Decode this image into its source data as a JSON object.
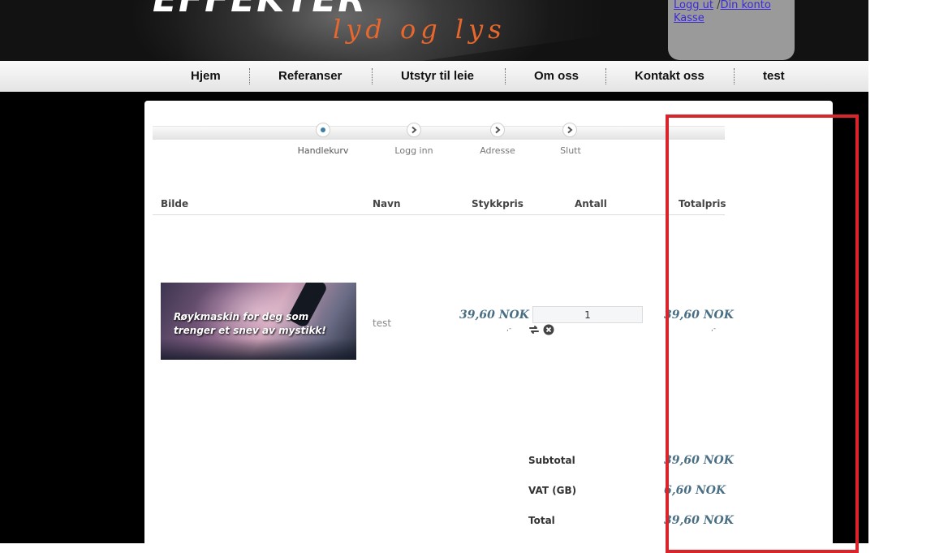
{
  "header": {
    "logo_main": "EFFEKTER",
    "logo_sub": "lyd og lys",
    "logout_link": "Logg ut",
    "separator": " /",
    "account_link": "Din konto",
    "checkout_link": "Kasse"
  },
  "nav": {
    "items": [
      {
        "label": "Hjem"
      },
      {
        "label": "Referanser"
      },
      {
        "label": "Utstyr til leie"
      },
      {
        "label": "Om oss"
      },
      {
        "label": "Kontakt oss"
      },
      {
        "label": "test"
      }
    ]
  },
  "steps": [
    {
      "label": "Handlekurv",
      "active": true
    },
    {
      "label": "Logg inn",
      "active": false
    },
    {
      "label": "Adresse",
      "active": false
    },
    {
      "label": "Slutt",
      "active": false
    }
  ],
  "table": {
    "headers": {
      "image": "Bilde",
      "name": "Navn",
      "unit_price": "Stykkpris",
      "quantity": "Antall",
      "total_price": "Totalpris"
    },
    "rows": [
      {
        "image_caption": "Røykmaskin for deg som trenger et snev av mystikk!",
        "name": "test",
        "unit_price": "39,60 NOK",
        "unit_price_note": ",-",
        "quantity": "1",
        "total_price": "39,60 NOK",
        "total_price_note": ",-"
      }
    ]
  },
  "summary": {
    "subtotal_label": "Subtotal",
    "subtotal_value": "39,60 NOK",
    "vat_label": "VAT (GB)",
    "vat_value": "6,60 NOK",
    "total_label": "Total",
    "total_value": "39,60 NOK"
  },
  "colors": {
    "price": "#4a6f85",
    "highlight_box": "#d9242b",
    "logo_sub": "#e8672c",
    "link": "#3a2ad8"
  },
  "icons": {
    "step_active": "dot-icon",
    "step_inactive": "chevron-right-icon",
    "update": "refresh-icon",
    "remove": "remove-circle-icon"
  }
}
